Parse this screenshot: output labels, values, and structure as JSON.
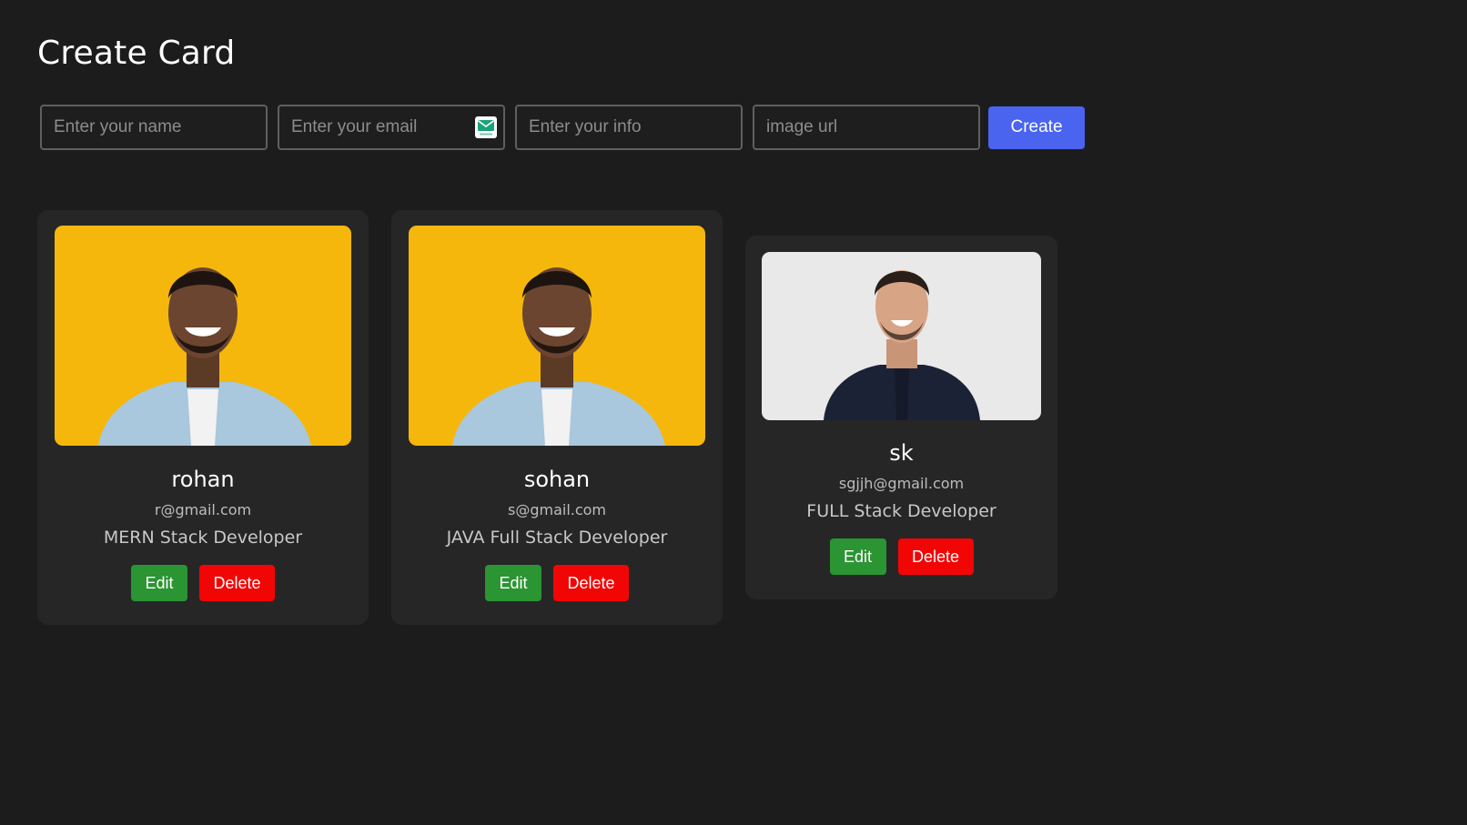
{
  "page": {
    "title": "Create Card"
  },
  "form": {
    "name_placeholder": "Enter your name",
    "email_placeholder": "Enter your email",
    "info_placeholder": "Enter your info",
    "image_placeholder": "image url",
    "create_label": "Create",
    "email_field_icon": "mail-icon"
  },
  "cards": [
    {
      "name": "rohan",
      "email": "r@gmail.com",
      "info": "MERN Stack Developer",
      "edit_label": "Edit",
      "delete_label": "Delete",
      "image": "photo-smiling-man-yellow-background"
    },
    {
      "name": "sohan",
      "email": "s@gmail.com",
      "info": "JAVA Full Stack Developer",
      "edit_label": "Edit",
      "delete_label": "Delete",
      "image": "photo-smiling-man-yellow-background"
    },
    {
      "name": "sk",
      "email": "sgjjh@gmail.com",
      "info": "FULL Stack Developer",
      "edit_label": "Edit",
      "delete_label": "Delete",
      "image": "photo-smiling-man-grey-background"
    }
  ],
  "colors": {
    "background": "#1c1c1c",
    "card": "#262626",
    "primary": "#4a64f0",
    "edit": "#2b9433",
    "delete": "#f20505"
  }
}
